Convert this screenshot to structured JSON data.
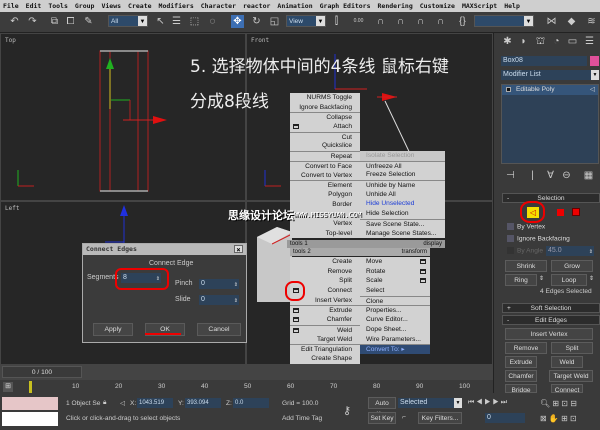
{
  "menubar": [
    "File",
    "Edit",
    "Tools",
    "Group",
    "Views",
    "Create",
    "Modifiers",
    "Character",
    "reactor",
    "Animation",
    "Graph Editors",
    "Rendering",
    "Customize",
    "MAXScript",
    "Help"
  ],
  "toolbar": {
    "selection_filter": "All",
    "ref_coord": "View",
    "angle_snap": "0.00"
  },
  "viewports": {
    "top": "Top",
    "front": "Front",
    "left": "Left"
  },
  "caption": {
    "line1": "5. 选择物体中间的4条线  鼠标右键",
    "line2": "分成8段线"
  },
  "watermark": {
    "cn": "思缘设计论坛",
    "url": "WWW.MISSYUAN.COM"
  },
  "quad": {
    "upper_left": [
      {
        "label": "NURMS Toggle"
      },
      {
        "label": "Ignore Backfacing"
      },
      {
        "label": "Collapse",
        "sep": true
      },
      {
        "label": "Attach",
        "box": true
      },
      {
        "label": "Cut",
        "sep": true
      },
      {
        "label": "Quickslice"
      },
      {
        "label": "Repeat",
        "sep": true
      },
      {
        "label": "Convert to Face",
        "sep": true
      },
      {
        "label": "Convert to Vertex"
      },
      {
        "label": "Element",
        "sep": true
      },
      {
        "label": "Polygon"
      },
      {
        "label": "Border"
      },
      {
        "label": ""
      },
      {
        "label": "Vertex"
      },
      {
        "label": "Top-level"
      }
    ],
    "upper_right": [
      {
        "label": "Isolate Selection",
        "dim": true
      },
      {
        "label": "Unfreeze All",
        "sep": true
      },
      {
        "label": "Freeze Selection"
      },
      {
        "label": "Unhide by Name",
        "sep": true
      },
      {
        "label": "Unhide All"
      },
      {
        "label": "Hide Unselected",
        "blue": true
      },
      {
        "label": "Hide Selection"
      },
      {
        "label": "Save Scene State...",
        "sep": true
      },
      {
        "label": "Manage Scene States..."
      }
    ],
    "bar_tools1": "tools 1",
    "bar_display": "display",
    "bar_tools2": "tools 2",
    "bar_transform": "transform",
    "lower_left": [
      {
        "label": "Create"
      },
      {
        "label": "Remove"
      },
      {
        "label": "Split"
      },
      {
        "label": "Connect",
        "box": true
      },
      {
        "label": "Insert Vertex"
      },
      {
        "label": "Extrude",
        "box": true,
        "sep": true
      },
      {
        "label": "Chamfer",
        "box": true
      },
      {
        "label": "Weld",
        "box": true,
        "sep": true
      },
      {
        "label": "Target Weld"
      },
      {
        "label": "Edit Triangulation",
        "sep": true
      },
      {
        "label": "Create Shape"
      }
    ],
    "lower_right": [
      {
        "label": "Move",
        "box": true
      },
      {
        "label": "Rotate",
        "box": true
      },
      {
        "label": "Scale",
        "box": true
      },
      {
        "label": "Select"
      },
      {
        "label": "Clone",
        "sep": true
      },
      {
        "label": "Properties...",
        "sep": true
      },
      {
        "label": "Curve Editor..."
      },
      {
        "label": "Dope Sheet..."
      },
      {
        "label": "Wire Parameters..."
      },
      {
        "label": "Convert To:  ▸",
        "hl": true,
        "sep": true
      }
    ]
  },
  "dialog": {
    "title": "Connect Edges",
    "group": "Connect Edge",
    "segments_label": "Segments",
    "segments": "8",
    "pinch_label": "Pinch",
    "pinch": "0",
    "slide_label": "Slide",
    "slide": "0",
    "apply": "Apply",
    "ok": "OK",
    "cancel": "Cancel"
  },
  "panel": {
    "object_name": "Box08",
    "object_color": "#e0509a",
    "modifier_list": "Modifier List",
    "stack_item": "Editable Poly",
    "selection_rollout": "Selection",
    "by_vertex": "By Vertex",
    "ignore_backfacing": "Ignore Backfacing",
    "by_angle": "By Angle",
    "angle_value": "45.0",
    "shrink": "Shrink",
    "grow": "Grow",
    "ring": "Ring",
    "loop": "Loop",
    "selected_info": "4 Edges Selected",
    "soft_selection": "Soft Selection",
    "edit_edges": "Edit Edges",
    "insert_vertex": "Insert Vertex",
    "remove": "Remove",
    "split": "Split",
    "extrude": "Extrude",
    "weld": "Weld",
    "chamfer": "Chamfer",
    "target_weld": "Target Weld",
    "bridge": "Bridge",
    "connect": "Connect"
  },
  "timeline": {
    "frame": "0 / 100",
    "ticks": [
      "10",
      "20",
      "30",
      "40",
      "50",
      "60",
      "70",
      "80",
      "90",
      "100"
    ]
  },
  "status": {
    "objects": "1 Object Se",
    "x_label": "X:",
    "x": "1043.519",
    "y_label": "Y:",
    "y": "393.094",
    "z_label": "Z:",
    "z": "0.0",
    "grid": "Grid = 100.0",
    "prompt": "Click or click-and-drag to select objects",
    "add_time_tag": "Add Time Tag",
    "auto_key": "Auto Key",
    "set_key": "Set Key",
    "key_mode": "Selected",
    "key_filters": "Key Filters...",
    "current_frame": "0"
  }
}
